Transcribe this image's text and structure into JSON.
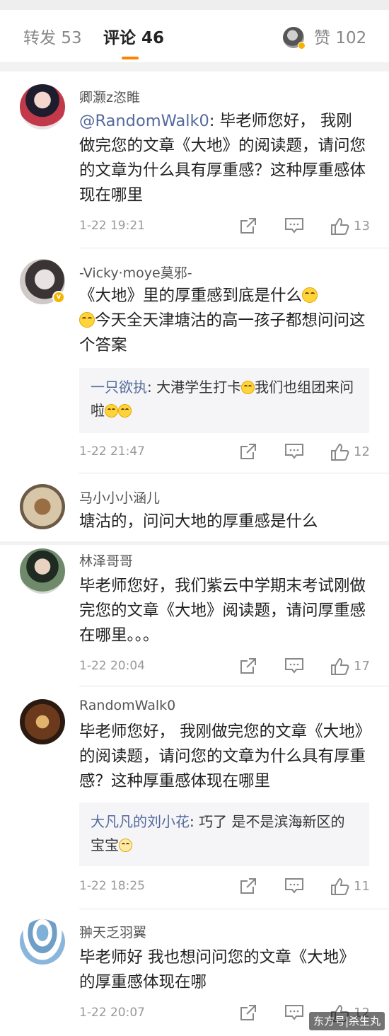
{
  "tabs": {
    "repost": {
      "label": "转发",
      "count": "53"
    },
    "comment": {
      "label": "评论",
      "count": "46"
    },
    "like": {
      "label": "赞",
      "count": "102"
    }
  },
  "comments": [
    {
      "name": "卿灏z恣睢",
      "mention": "@RandomWalk0",
      "text": ": 毕老师您好， 我刚做完您的文章《大地》的阅读题，请问您的文章为什么具有厚重感？这种厚重感体现在哪里",
      "time": "1-22 19:21",
      "likes": "13"
    },
    {
      "name": "-Vicky·moye莫邪-",
      "text_a": "《大地》里的厚重感到底是什么",
      "text_b": "今天全天津塘沽的高一孩子都想问问这个答案",
      "reply_name": "一只欲执",
      "reply_a": ": 大港学生打卡",
      "reply_b": "我们也组团来问啦",
      "time": "1-22 21:47",
      "likes": "12"
    },
    {
      "name": "马小小小涵儿",
      "text": "塘沽的，问问大地的厚重感是什么"
    },
    {
      "name": "林泽哥哥",
      "text": "毕老师您好，我们紫云中学期末考试刚做完您的文章《大地》阅读题，请问厚重感在哪里。。。",
      "time": "1-22 20:04",
      "likes": "17"
    },
    {
      "name": "RandomWalk0",
      "text": "毕老师您好， 我刚做完您的文章《大地》的阅读题，请问您的文章为什么具有厚重感？这种厚重感体现在哪里",
      "reply_name": "大凡凡的刘小花",
      "reply_text": ": 巧了 是不是滨海新区的宝宝",
      "time": "1-22 18:25",
      "likes": "11"
    },
    {
      "name": "翀天乏羽翼",
      "text": "毕老师好 我也想问问您的文章《大地》的厚重感体现在哪",
      "time": "1-22 20:07",
      "likes": "12"
    }
  ],
  "watermark": "东方号|杀生丸"
}
